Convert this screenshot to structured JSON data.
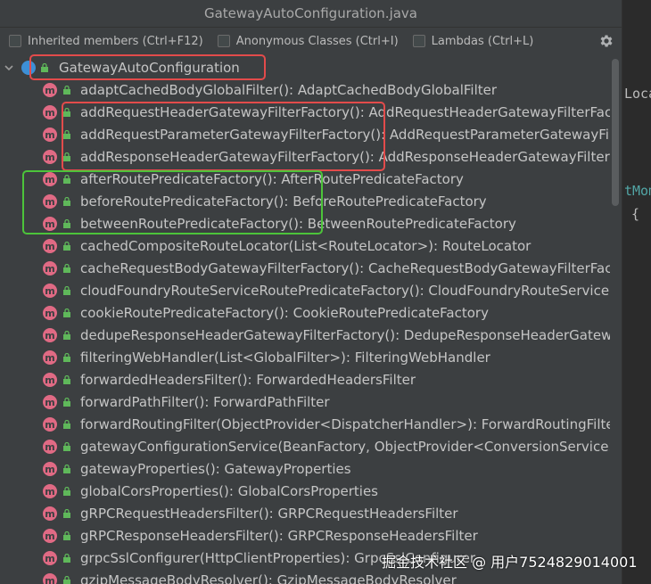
{
  "window": {
    "title": "GatewayAutoConfiguration.java"
  },
  "filters": [
    {
      "label": "Inherited members (Ctrl+F12)"
    },
    {
      "label": "Anonymous Classes (Ctrl+I)"
    },
    {
      "label": "Lambdas (Ctrl+L)"
    }
  ],
  "settings_icon": "gear-icon",
  "tree": {
    "root": {
      "label": "GatewayAutoConfiguration",
      "icon": "class-icon"
    },
    "method_badge": "m",
    "items": [
      {
        "label": "adaptCachedBodyGlobalFilter(): AdaptCachedBodyGlobalFilter"
      },
      {
        "label": "addRequestHeaderGatewayFilterFactory(): AddRequestHeaderGatewayFilterFactory"
      },
      {
        "label": "addRequestParameterGatewayFilterFactory(): AddRequestParameterGatewayFilterFactory"
      },
      {
        "label": "addResponseHeaderGatewayFilterFactory(): AddResponseHeaderGatewayFilterFactory"
      },
      {
        "label": "afterRoutePredicateFactory(): AfterRoutePredicateFactory"
      },
      {
        "label": "beforeRoutePredicateFactory(): BeforeRoutePredicateFactory"
      },
      {
        "label": "betweenRoutePredicateFactory(): BetweenRoutePredicateFactory"
      },
      {
        "label": "cachedCompositeRouteLocator(List<RouteLocator>): RouteLocator"
      },
      {
        "label": "cacheRequestBodyGatewayFilterFactory(): CacheRequestBodyGatewayFilterFactory"
      },
      {
        "label": "cloudFoundryRouteServiceRoutePredicateFactory(): CloudFoundryRouteServiceRoutePredicateFactory"
      },
      {
        "label": "cookieRoutePredicateFactory(): CookieRoutePredicateFactory"
      },
      {
        "label": "dedupeResponseHeaderGatewayFilterFactory(): DedupeResponseHeaderGatewayFilterFactory"
      },
      {
        "label": "filteringWebHandler(List<GlobalFilter>): FilteringWebHandler"
      },
      {
        "label": "forwardedHeadersFilter(): ForwardedHeadersFilter"
      },
      {
        "label": "forwardPathFilter(): ForwardPathFilter"
      },
      {
        "label": "forwardRoutingFilter(ObjectProvider<DispatcherHandler>): ForwardRoutingFilter"
      },
      {
        "label": "gatewayConfigurationService(BeanFactory, ObjectProvider<ConversionService>, ObjectProvider<Validator>): ConfigurationService"
      },
      {
        "label": "gatewayProperties(): GatewayProperties"
      },
      {
        "label": "globalCorsProperties(): GlobalCorsProperties"
      },
      {
        "label": "gRPCRequestHeadersFilter(): GRPCRequestHeadersFilter"
      },
      {
        "label": "gRPCResponseHeadersFilter(): GRPCResponseHeadersFilter"
      },
      {
        "label": "grpcSslConfigurer(HttpClientProperties): GrpcSslConfigurer"
      },
      {
        "label": "gzipMessageBodyResolver(): GzipMessageBodyResolver"
      }
    ]
  },
  "editor": {
    "lines": [
      "Locat",
      "tMom",
      "{"
    ]
  },
  "highlight_colors": {
    "red": "#e34b4b",
    "green": "#4cc43a"
  },
  "watermark": "掘金技术社区 @ 用户7524829014001"
}
